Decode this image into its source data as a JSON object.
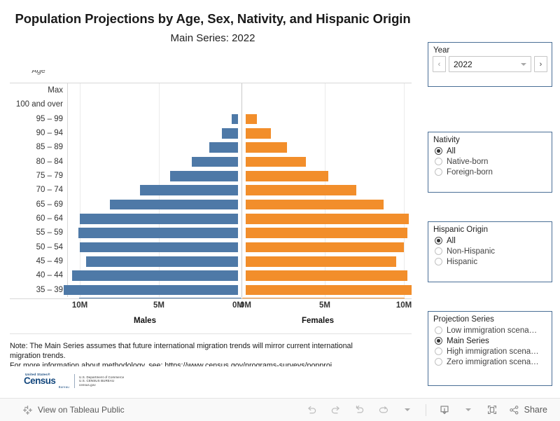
{
  "title": {
    "main": "Population Projections by Age, Sex, Nativity, and Hispanic Origin",
    "sub": "Main Series: 2022"
  },
  "chart_data": {
    "type": "bar",
    "subtype": "population-pyramid",
    "title": "Population Projections by Age, Sex, Nativity, and Hispanic Origin",
    "subtitle": "Main Series: 2022",
    "axis_header": "Age",
    "xlabel_left": "Males",
    "xlabel_right": "Females",
    "ylabel": "Age",
    "grid": true,
    "legend_position": "none",
    "xlim_left": [
      10000000,
      0
    ],
    "xlim_right": [
      0,
      10000000
    ],
    "xticks_left": [
      "10M",
      "5M",
      "0M"
    ],
    "xticks_right": [
      "0M",
      "5M",
      "10M"
    ],
    "xtick_values_left": [
      10000000,
      5000000,
      0
    ],
    "xtick_values_right": [
      0,
      5000000,
      10000000
    ],
    "categories": [
      "Max",
      "100 and over",
      "95 – 99",
      "90 – 94",
      "85 – 89",
      "80 – 84",
      "75 – 79",
      "70 – 74",
      "65 – 69",
      "60 – 64",
      "55 – 59",
      "50 – 54",
      "45 – 49",
      "40 – 44",
      "35 – 39"
    ],
    "series": [
      {
        "name": "Males",
        "color": "#4e79a7",
        "values": [
          0,
          0,
          400000,
          1000000,
          1800000,
          2900000,
          4300000,
          6200000,
          8100000,
          10000000,
          10100000,
          10000000,
          9600000,
          10500000,
          11000000
        ]
      },
      {
        "name": "Females",
        "color": "#f28e2b",
        "values": [
          0,
          0,
          700000,
          1600000,
          2600000,
          3800000,
          5200000,
          7000000,
          8700000,
          10300000,
          10200000,
          10000000,
          9500000,
          10200000,
          10500000
        ]
      }
    ],
    "note": "Note: The Main Series assumes that future international migration trends will mirror current international migration trends.",
    "note_clipped_line": "For more information about methodology, see: https://www.census.gov/programs-surveys/popproj/technical-documentation.html"
  },
  "colors": {
    "males": "#4e79a7",
    "females": "#f28e2b",
    "panel_border": "#4a6f96",
    "link": "#5a8fc0"
  },
  "note": {
    "line1": "Note: The Main Series assumes that future international migration trends will mirror current international",
    "line2": "migration trends.",
    "line3": "For more information about methodology, see: https://www.census.gov/programs-surveys/popproj"
  },
  "logo": {
    "us": "United States®",
    "wordmark": "Census",
    "bureau": "Bureau",
    "dept_line1": "U.S. Department of Commerce",
    "dept_line2": "U.S. CENSUS BUREAU",
    "dept_line3": "census.gov"
  },
  "filters": {
    "year": {
      "title": "Year",
      "value": "2022",
      "prev_label": "‹",
      "next_label": "›"
    },
    "nativity": {
      "title": "Nativity",
      "selected": "All",
      "options": [
        "All",
        "Native-born",
        "Foreign-born"
      ]
    },
    "hispanic_origin": {
      "title": "Hispanic Origin",
      "selected": "All",
      "options": [
        "All",
        "Non-Hispanic",
        "Hispanic"
      ]
    },
    "projection_series": {
      "title": "Projection Series",
      "selected": "Main Series",
      "options": [
        "Low immigration scena…",
        "Main Series",
        "High immigration scena…",
        "Zero immigration scena…"
      ]
    }
  },
  "toolbar": {
    "tableau_link": "View on Tableau Public",
    "share_label": "Share"
  }
}
